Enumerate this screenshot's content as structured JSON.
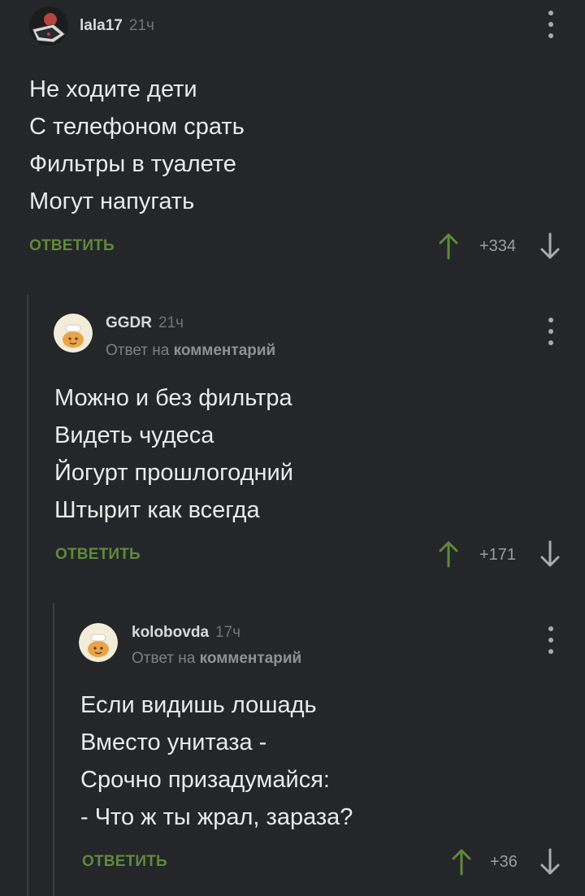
{
  "reply_to": {
    "prefix": "Ответ на",
    "target": "комментарий"
  },
  "comments": [
    {
      "author": "lala17",
      "time": "21ч",
      "lines": [
        "Не ходите дети",
        "С телефоном срать",
        "Фильтры в туалете",
        "Могут напугать"
      ],
      "reply_label": "ОТВЕТИТЬ",
      "rating": "+334"
    },
    {
      "author": "GGDR",
      "time": "21ч",
      "lines": [
        "Можно и без фильтра",
        "Видеть чудеса",
        "Йогурт прошлогодний",
        "Штырит как всегда"
      ],
      "reply_label": "ОТВЕТИТЬ",
      "rating": "+171"
    },
    {
      "author": "kolobovda",
      "time": "17ч",
      "lines": [
        "Если видишь лошадь",
        "Вместо унитаза -",
        "Срочно призадумайся:",
        "- Что ж ты жрал, зараза?"
      ],
      "reply_label": "ОТВЕТИТЬ",
      "rating": "+36"
    }
  ],
  "colors": {
    "background": "#24262a",
    "reply": "#5f8a3a",
    "upvote": "#5f8a3a",
    "downvote": "#a8abb0"
  },
  "icons": {
    "upvote": "arrow-up-icon",
    "downvote": "arrow-down-icon",
    "menu": "more-vertical-icon"
  }
}
